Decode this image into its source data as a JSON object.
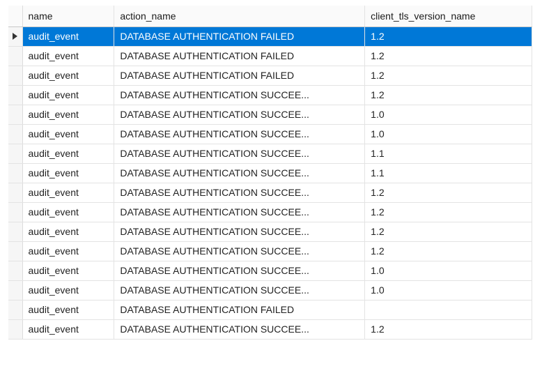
{
  "grid": {
    "columns": {
      "name": "name",
      "action_name": "action_name",
      "client_tls_version_name": "client_tls_version_name"
    },
    "rows": [
      {
        "name": "audit_event",
        "action_name": "DATABASE AUTHENTICATION FAILED",
        "client_tls_version_name": "1.2",
        "selected": true,
        "truncated": false
      },
      {
        "name": "audit_event",
        "action_name": "DATABASE AUTHENTICATION FAILED",
        "client_tls_version_name": "1.2",
        "selected": false,
        "truncated": false
      },
      {
        "name": "audit_event",
        "action_name": "DATABASE AUTHENTICATION FAILED",
        "client_tls_version_name": "1.2",
        "selected": false,
        "truncated": false
      },
      {
        "name": "audit_event",
        "action_name": "DATABASE AUTHENTICATION SUCCEE...",
        "client_tls_version_name": "1.2",
        "selected": false,
        "truncated": true
      },
      {
        "name": "audit_event",
        "action_name": "DATABASE AUTHENTICATION SUCCEE...",
        "client_tls_version_name": "1.0",
        "selected": false,
        "truncated": true
      },
      {
        "name": "audit_event",
        "action_name": "DATABASE AUTHENTICATION SUCCEE...",
        "client_tls_version_name": "1.0",
        "selected": false,
        "truncated": true
      },
      {
        "name": "audit_event",
        "action_name": "DATABASE AUTHENTICATION SUCCEE...",
        "client_tls_version_name": "1.1",
        "selected": false,
        "truncated": true
      },
      {
        "name": "audit_event",
        "action_name": "DATABASE AUTHENTICATION SUCCEE...",
        "client_tls_version_name": "1.1",
        "selected": false,
        "truncated": true
      },
      {
        "name": "audit_event",
        "action_name": "DATABASE AUTHENTICATION SUCCEE...",
        "client_tls_version_name": "1.2",
        "selected": false,
        "truncated": true
      },
      {
        "name": "audit_event",
        "action_name": "DATABASE AUTHENTICATION SUCCEE...",
        "client_tls_version_name": "1.2",
        "selected": false,
        "truncated": true
      },
      {
        "name": "audit_event",
        "action_name": "DATABASE AUTHENTICATION SUCCEE...",
        "client_tls_version_name": "1.2",
        "selected": false,
        "truncated": true
      },
      {
        "name": "audit_event",
        "action_name": "DATABASE AUTHENTICATION SUCCEE...",
        "client_tls_version_name": "1.2",
        "selected": false,
        "truncated": true
      },
      {
        "name": "audit_event",
        "action_name": "DATABASE AUTHENTICATION SUCCEE...",
        "client_tls_version_name": "1.0",
        "selected": false,
        "truncated": true
      },
      {
        "name": "audit_event",
        "action_name": "DATABASE AUTHENTICATION SUCCEE...",
        "client_tls_version_name": "1.0",
        "selected": false,
        "truncated": true
      },
      {
        "name": "audit_event",
        "action_name": "DATABASE AUTHENTICATION FAILED",
        "client_tls_version_name": "",
        "selected": false,
        "truncated": false
      },
      {
        "name": "audit_event",
        "action_name": "DATABASE AUTHENTICATION SUCCEE...",
        "client_tls_version_name": "1.2",
        "selected": false,
        "truncated": true
      }
    ]
  }
}
